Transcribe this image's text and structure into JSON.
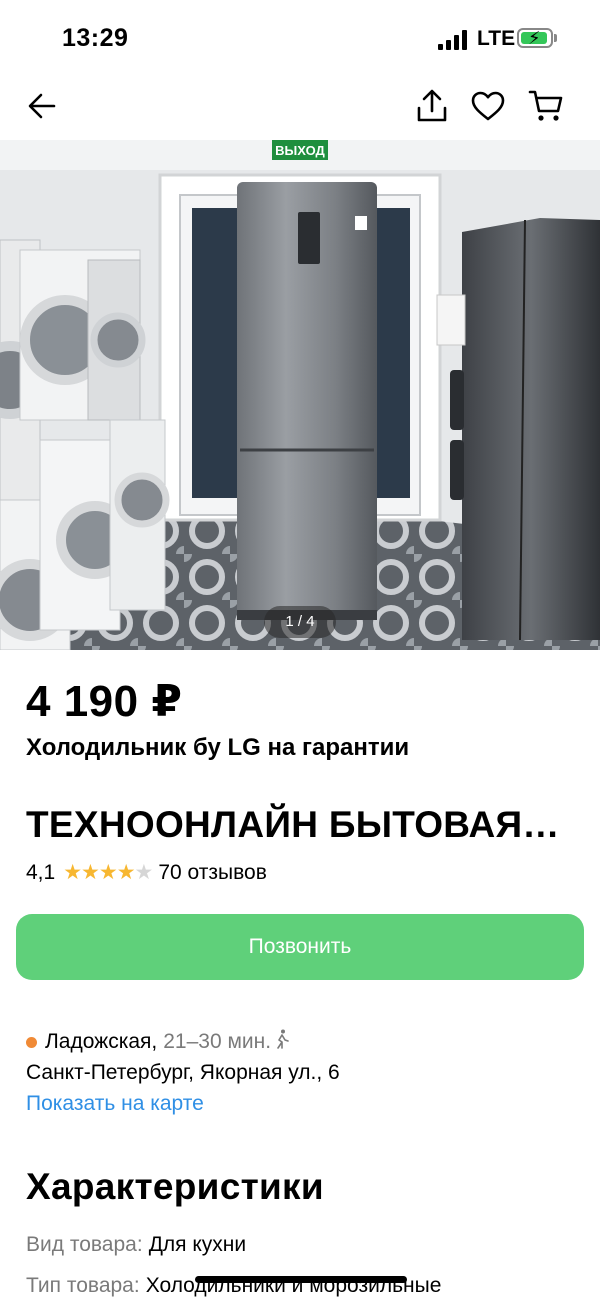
{
  "status_bar": {
    "time": "13:29",
    "network": "LTE"
  },
  "photo": {
    "counter": "1 / 4",
    "exit_sign": "ВЫХОД"
  },
  "listing": {
    "price": "4 190 ₽",
    "title": "Холодильник бу LG на гарантии"
  },
  "seller": {
    "name": "ТЕХНООНЛАЙН БЫТОВАЯ…",
    "rating": "4,1",
    "stars_filled": 4,
    "stars_total": 5,
    "reviews": "70 отзывов"
  },
  "actions": {
    "call_label": "Позвонить"
  },
  "location": {
    "metro": "Ладожская,",
    "metro_color": "#f08a36",
    "walk_time": "21–30 мин.",
    "address": "Санкт-Петербург, Якорная ул., 6",
    "map_link": "Показать на карте"
  },
  "characteristics": {
    "title": "Характеристики",
    "rows": [
      {
        "label": "Вид товара:",
        "value": "Для кухни"
      },
      {
        "label": "Тип товара:",
        "value": "Холодильники и морозильные"
      }
    ]
  },
  "colors": {
    "accent": "#5fd07a",
    "link": "#2f8fe5",
    "star": "#f7b731"
  },
  "icons": [
    "back-arrow-icon",
    "share-icon",
    "heart-icon",
    "cart-icon",
    "walking-icon",
    "signal-icon",
    "battery-icon"
  ]
}
